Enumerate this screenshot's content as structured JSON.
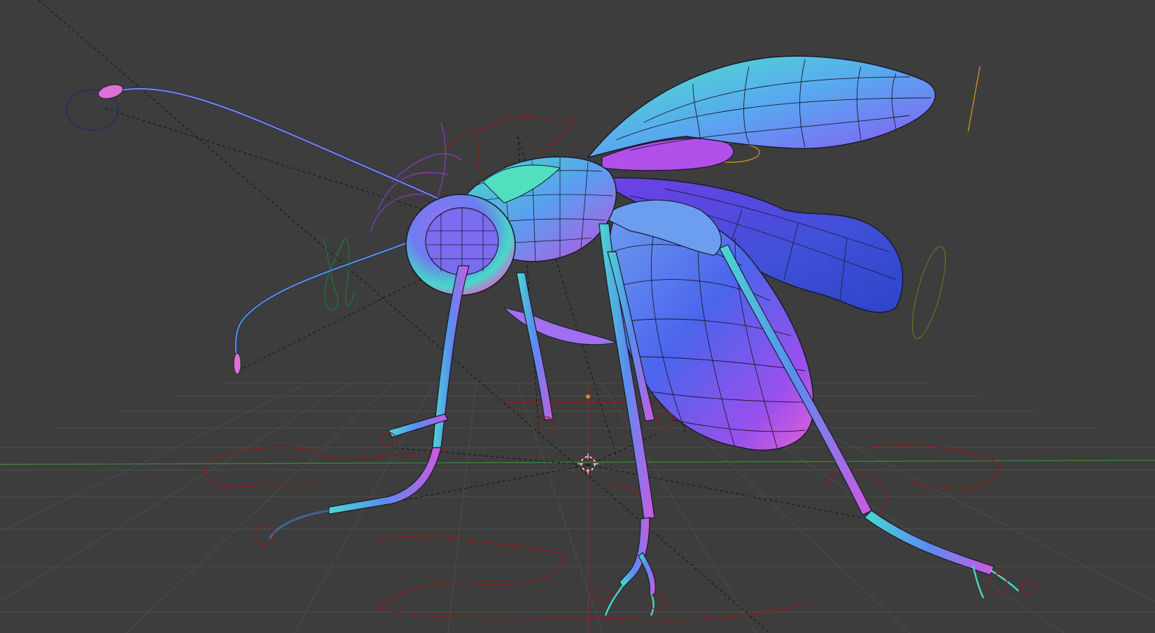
{
  "app": "3D viewport",
  "viewport": {
    "background": "#3d3d3d",
    "grid_color": "#4c4c4c",
    "x_axis_color": "#3c8a3c",
    "y_axis_color": "#a02828",
    "shading": "matcap-normal",
    "overlays": [
      "wireframe",
      "rig-controls",
      "grid-floor",
      "3d-cursor"
    ]
  },
  "scene": {
    "object": "insect-model",
    "parts": [
      "head",
      "antenna",
      "thorax",
      "abdomen",
      "wings",
      "legs",
      "rig-controls"
    ],
    "palette": {
      "cyan": "#44e0c8",
      "blue": "#4468e8",
      "violet": "#8a48e8",
      "magenta": "#e040e0",
      "rig_red": "#8c1c1c",
      "rig_orange": "#c8901c",
      "rig_green": "#1c7a3c",
      "rig_navy": "#222a70"
    }
  }
}
